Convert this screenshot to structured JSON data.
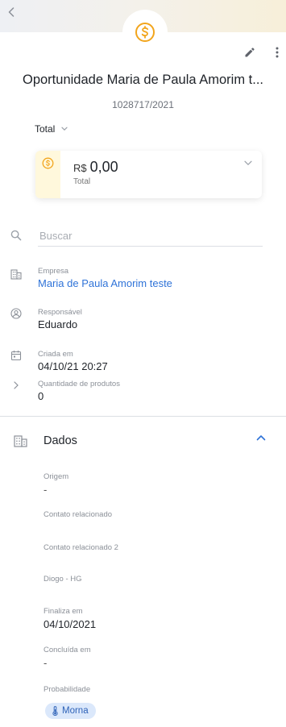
{
  "header": {
    "title": "Oportunidade Maria de Paula Amorim t...",
    "code": "1028717/2021"
  },
  "total_select": {
    "selected": "Total"
  },
  "value_card": {
    "currency": "R$",
    "amount": "0,00",
    "label": "Total"
  },
  "search": {
    "placeholder": "Buscar"
  },
  "info": {
    "empresa": {
      "label": "Empresa",
      "value": "Maria de Paula Amorim teste"
    },
    "responsavel": {
      "label": "Responsável",
      "value": "Eduardo"
    },
    "criada": {
      "label": "Criada em",
      "value": "04/10/21 20:27"
    },
    "quantidade": {
      "label": "Quantidade de produtos",
      "value": "0"
    }
  },
  "dados": {
    "title": "Dados",
    "fields": {
      "origem": {
        "label": "Origem",
        "value": "-"
      },
      "contato": {
        "label": "Contato relacionado"
      },
      "contato2": {
        "label": "Contato relacionado 2"
      },
      "diogo": {
        "label": "Diogo - HG"
      },
      "finaliza": {
        "label": "Finaliza em",
        "value": "04/10/2021"
      },
      "concluida": {
        "label": "Concluída em",
        "value": "-"
      },
      "probabilidade": {
        "label": "Probabilidade",
        "value": "Morna"
      }
    }
  },
  "colors": {
    "accent_blue": "#2f73d8",
    "coin_orange": "#f2a51c",
    "chip_bg": "#dbe8fb"
  }
}
